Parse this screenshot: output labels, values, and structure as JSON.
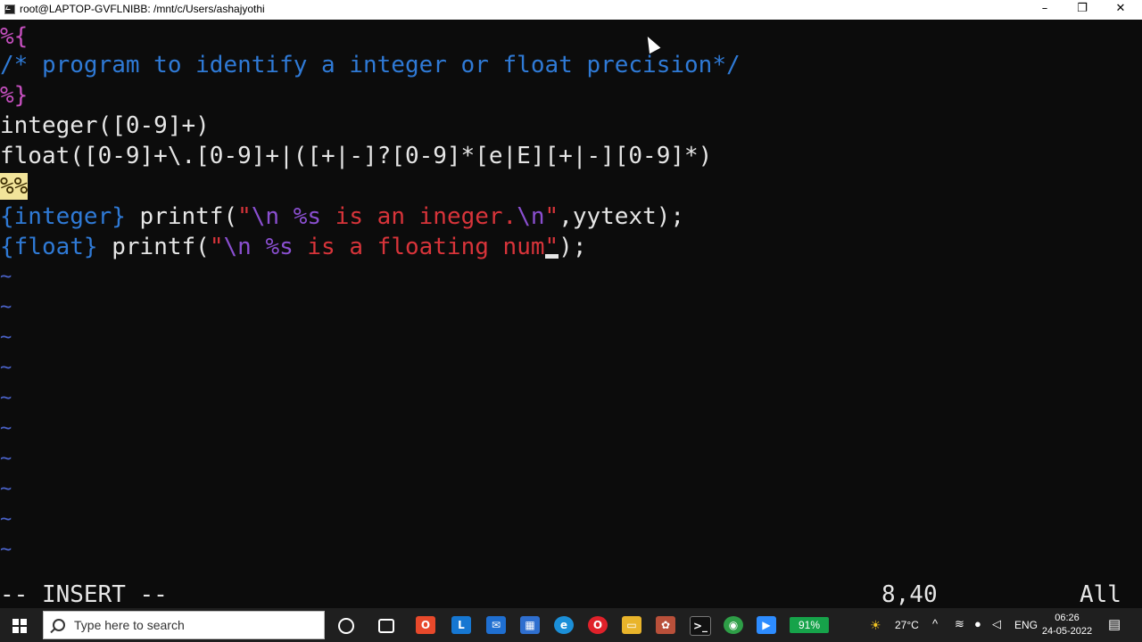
{
  "window": {
    "title": "root@LAPTOP-GVFLNIBB: /mnt/c/Users/ashajyothi",
    "minimize": "–",
    "restore": "❐",
    "close": "✕"
  },
  "editor": {
    "line1": "%{",
    "line2": "/* program to identify a integer or float precision*/",
    "line3": "%}",
    "line4": "integer([0-9]+)",
    "line5": "float([0-9]+\\.[0-9]+|([+|-]?[0-9]*[e|E][+|-][0-9]*)",
    "line6": "%%",
    "line7": {
      "pattern": "{integer}",
      "func": " printf(",
      "quote_open": "\"",
      "esc1": "\\n",
      "sp1": " ",
      "fmt": "%s",
      "text": " is an ineger.",
      "esc2": "\\n",
      "quote_close": "\"",
      "rest": ",yytext);"
    },
    "line8": {
      "pattern": "{float}",
      "func": " printf(",
      "quote_open": "\"",
      "esc1": "\\n",
      "sp1": " ",
      "fmt": "%s",
      "text": " is a floating num",
      "cursor_char": "\"",
      "rest": ");"
    },
    "tilde": "~",
    "mode": "-- INSERT --",
    "position": "8,40",
    "scroll": "All"
  },
  "taskbar": {
    "search_placeholder": "Type here to search",
    "battery": "91%",
    "temperature": "27°C",
    "language": "ENG",
    "time": "06:26",
    "date": "24-05-2022"
  }
}
